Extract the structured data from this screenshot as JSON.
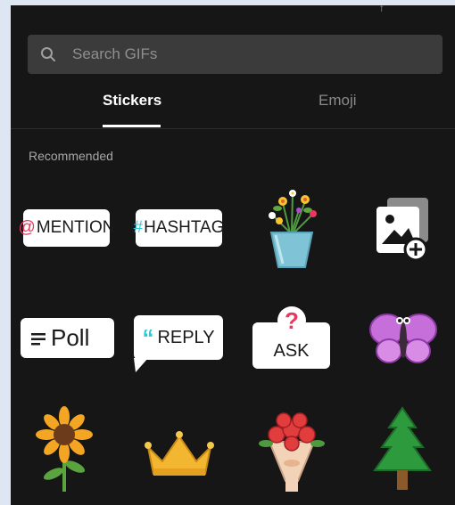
{
  "search": {
    "placeholder": "Search GIFs",
    "icon": "search-icon"
  },
  "tabs": [
    {
      "label": "Stickers",
      "active": true
    },
    {
      "label": "Emoji",
      "active": false
    }
  ],
  "section": {
    "label": "Recommended"
  },
  "stickers": {
    "mention": {
      "symbol": "@",
      "text": "MENTION"
    },
    "hashtag": {
      "symbol": "#",
      "text": "HASHTAG"
    },
    "poll": {
      "text": "Poll"
    },
    "reply": {
      "symbol": "“",
      "text": "REPLY"
    },
    "ask": {
      "symbol": "?",
      "text": "ASK"
    },
    "icons": [
      "flowers-vase-icon",
      "add-photo-icon",
      "butterfly-icon",
      "sunflower-icon",
      "crown-icon",
      "rose-bouquet-icon",
      "pine-tree-icon"
    ]
  },
  "colors": {
    "background": "#161616",
    "search_bg": "#3b3b3b",
    "mention_accent": "#e8385f",
    "hashtag_accent": "#2fc6d6"
  }
}
